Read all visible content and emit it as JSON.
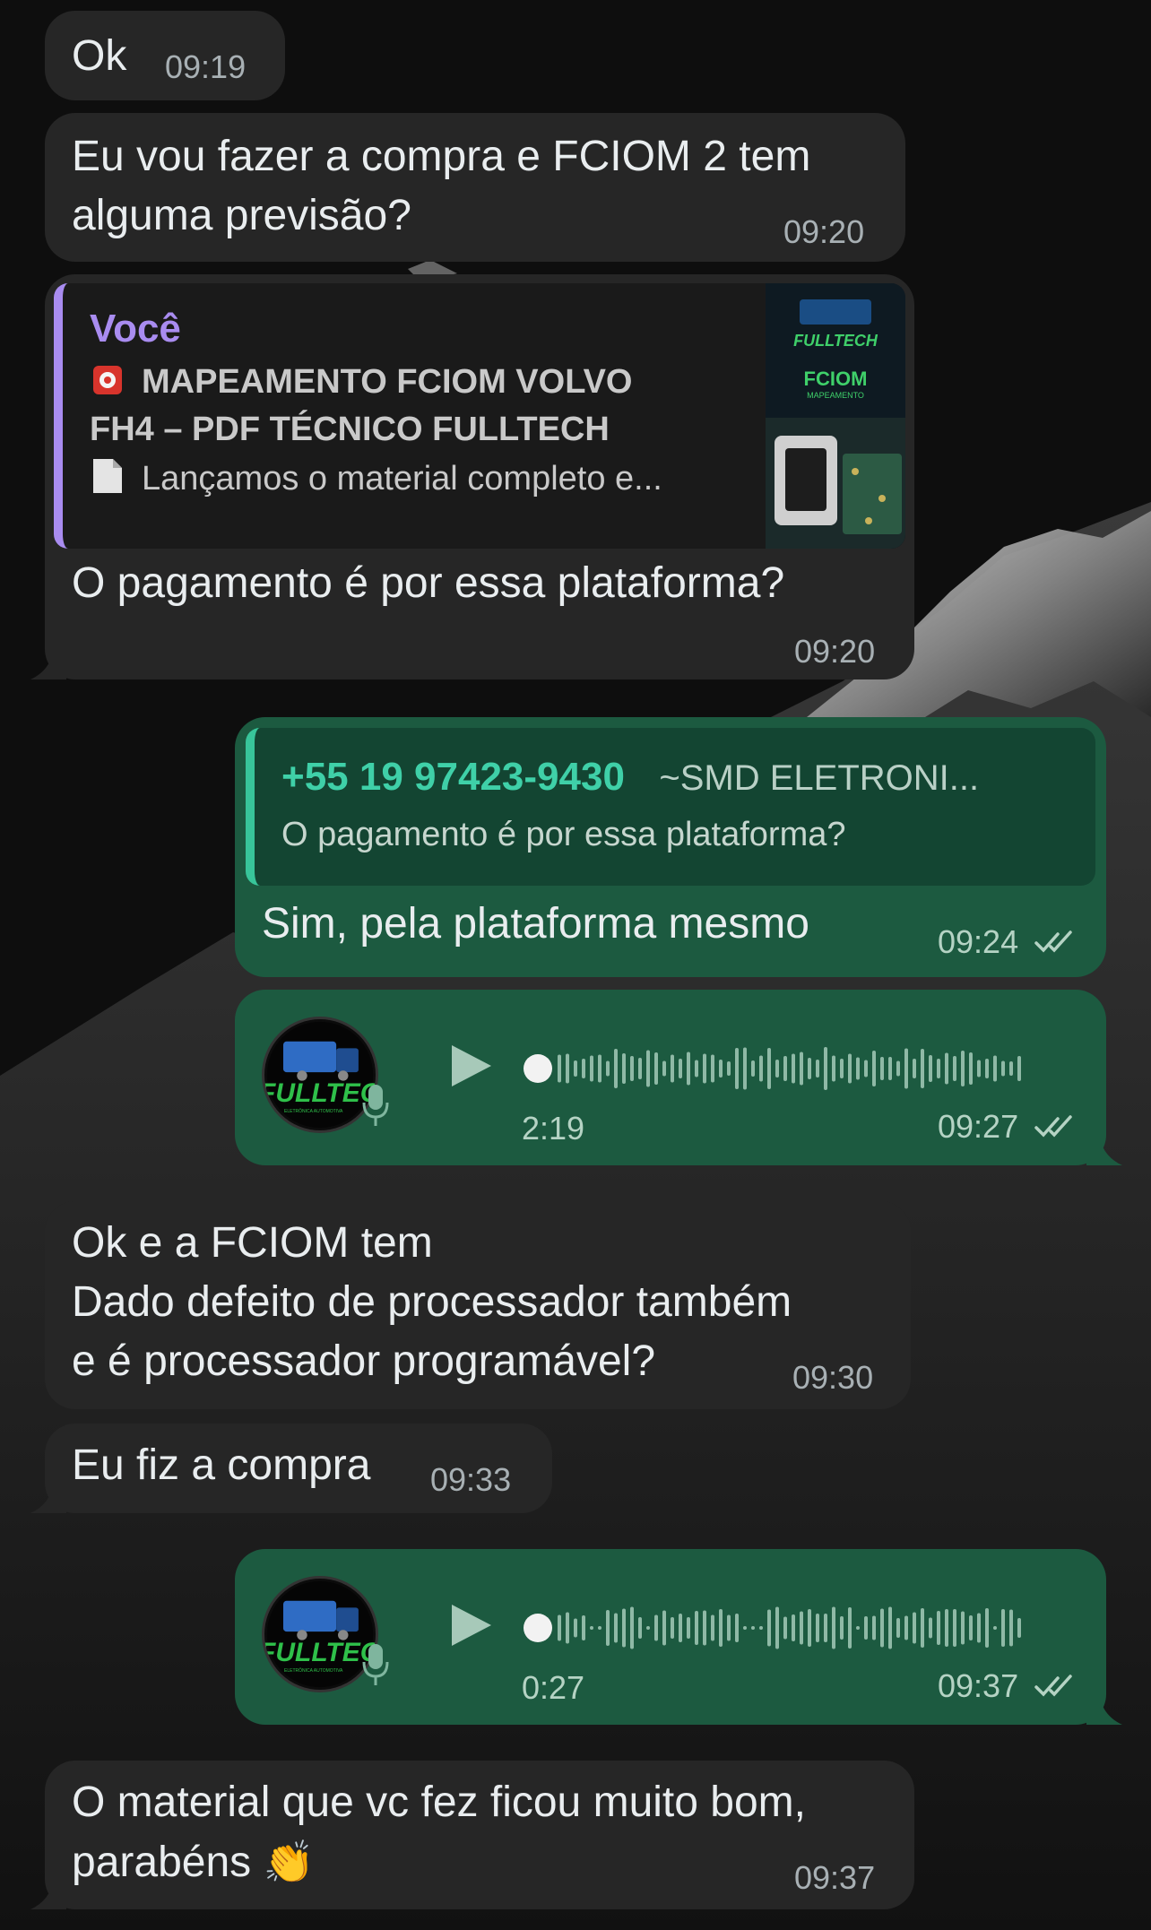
{
  "messages": [
    {
      "text": "Ok",
      "time": "09:19"
    },
    {
      "text": "Eu vou fazer a compra e FCIOM 2 tem\nalguma previsão?",
      "time": "09:20"
    },
    {
      "quote": {
        "author": "Você",
        "line1": "MAPEAMENTO FCIOM VOLVO",
        "line2": "FH4 – PDF TÉCNICO FULLTECH",
        "line3": "Lançamos o material completo e...",
        "thumb_brand": "FULLTECH",
        "thumb_title": "FCIOM",
        "thumb_sub": "MAPEAMENTO"
      },
      "text": "O pagamento é por essa plataforma?",
      "time": "09:20"
    },
    {
      "quote": {
        "phone": "+55 19 97423-9430",
        "name": "~SMD ELETRONI...",
        "text": "O pagamento é por essa plataforma?"
      },
      "text": "Sim, pela plataforma mesmo",
      "time": "09:24"
    },
    {
      "audio_duration": "2:19",
      "time": "09:27",
      "avatar_brand": "FULLTECH",
      "avatar_sub": "ELETRÔNICA AUTOMOTIVA"
    },
    {
      "text": "Ok e a FCIOM tem\nDado defeito de processador também\ne é processador programável?",
      "time": "09:30"
    },
    {
      "text": "Eu fiz a compra",
      "time": "09:33"
    },
    {
      "audio_duration": "0:27",
      "time": "09:37",
      "avatar_brand": "FULLTECH",
      "avatar_sub": "ELETRÔNICA AUTOMOTIVA"
    },
    {
      "text": "O material que vc fez ficou muito bom,\nparabéns",
      "emoji": "👏",
      "time": "09:37"
    }
  ],
  "icons": {
    "siren": "siren-emoji-icon",
    "document": "document-emoji-icon",
    "play": "play-icon",
    "mic": "microphone-icon",
    "read": "double-check-icon"
  },
  "colors": {
    "incoming_bubble": "#262626",
    "outgoing_bubble": "#1c5a40",
    "quote_you_accent": "#a98cf0",
    "quote_contact_accent": "#38c59a",
    "contact_phone": "#3fd0a8"
  }
}
